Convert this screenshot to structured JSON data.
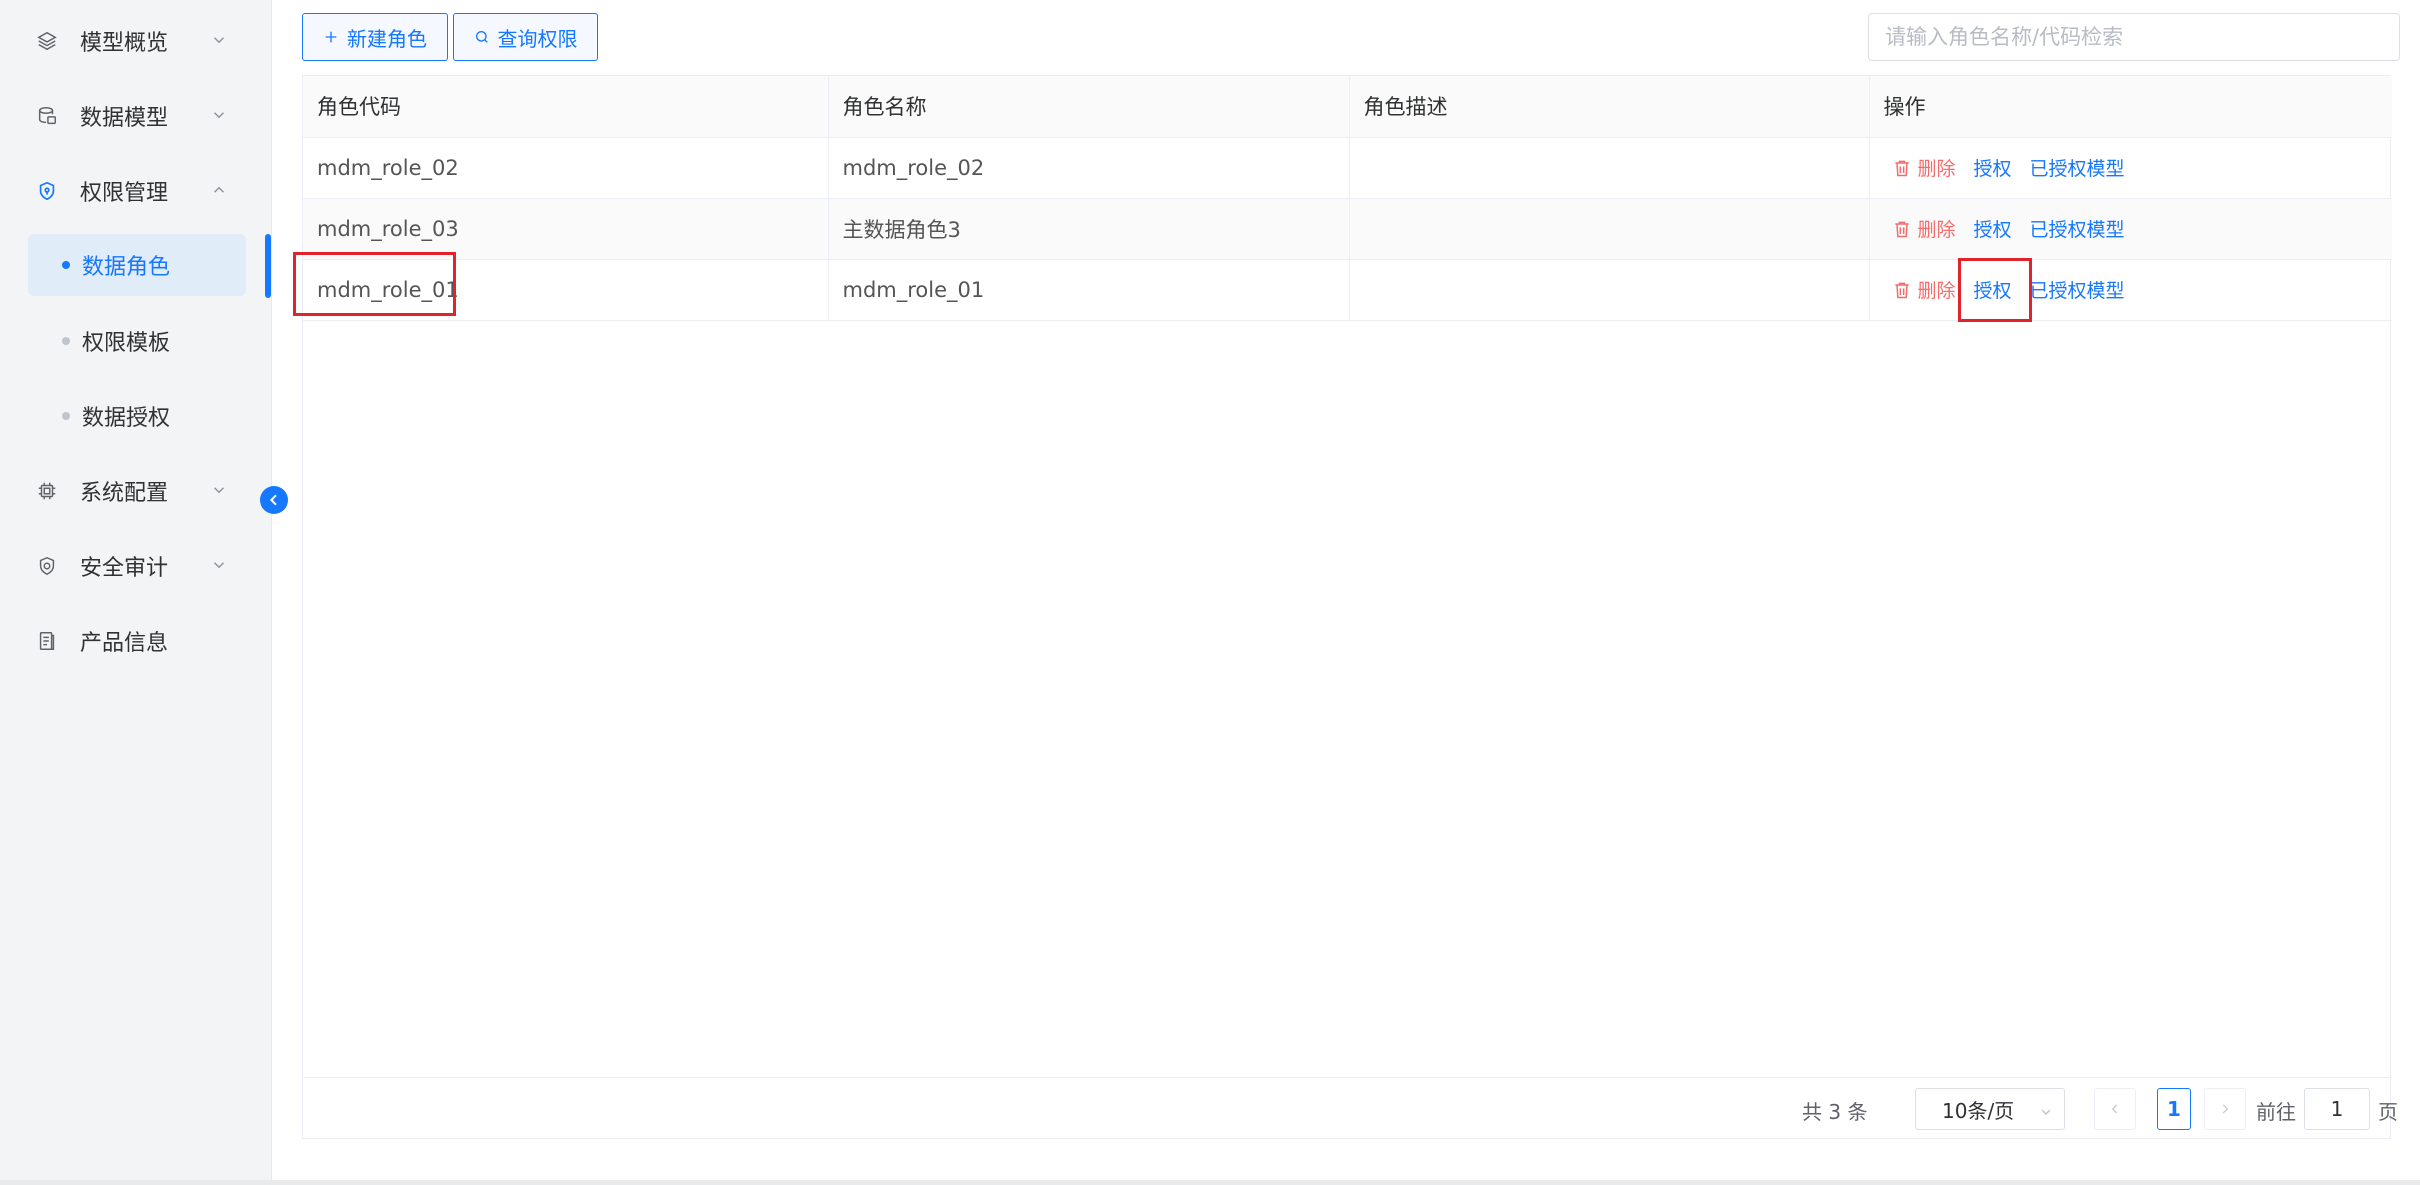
{
  "sidebar": {
    "items": [
      {
        "label": "模型概览",
        "icon": "layers-icon"
      },
      {
        "label": "数据模型",
        "icon": "database-icon"
      },
      {
        "label": "权限管理",
        "icon": "shield-icon"
      },
      {
        "label": "系统配置",
        "icon": "chip-icon"
      },
      {
        "label": "安全审计",
        "icon": "shield-check-icon"
      },
      {
        "label": "产品信息",
        "icon": "document-icon"
      }
    ],
    "submenu": [
      {
        "label": "数据角色",
        "active": true
      },
      {
        "label": "权限模板",
        "active": false
      },
      {
        "label": "数据授权",
        "active": false
      }
    ]
  },
  "toolbar": {
    "new_role_label": "新建角色",
    "query_permission_label": "查询权限",
    "search_placeholder": "请输入角色名称/代码检索"
  },
  "table": {
    "columns": [
      "角色代码",
      "角色名称",
      "角色描述",
      "操作"
    ],
    "rows": [
      {
        "code": "mdm_role_02",
        "name": "mdm_role_02",
        "desc": ""
      },
      {
        "code": "mdm_role_03",
        "name": "主数据角色3",
        "desc": ""
      },
      {
        "code": "mdm_role_01",
        "name": "mdm_role_01",
        "desc": ""
      }
    ],
    "actions": {
      "delete": "删除",
      "authorize": "授权",
      "authorized_models": "已授权模型"
    }
  },
  "pagination": {
    "total_text": "共 3 条",
    "page_size": "10条/页",
    "current_page": "1",
    "goto_label": "前往",
    "goto_value": "1",
    "page_suffix": "页"
  },
  "colors": {
    "accent": "#1677ff",
    "danger": "#f56c6c",
    "highlight": "#e0242c"
  }
}
